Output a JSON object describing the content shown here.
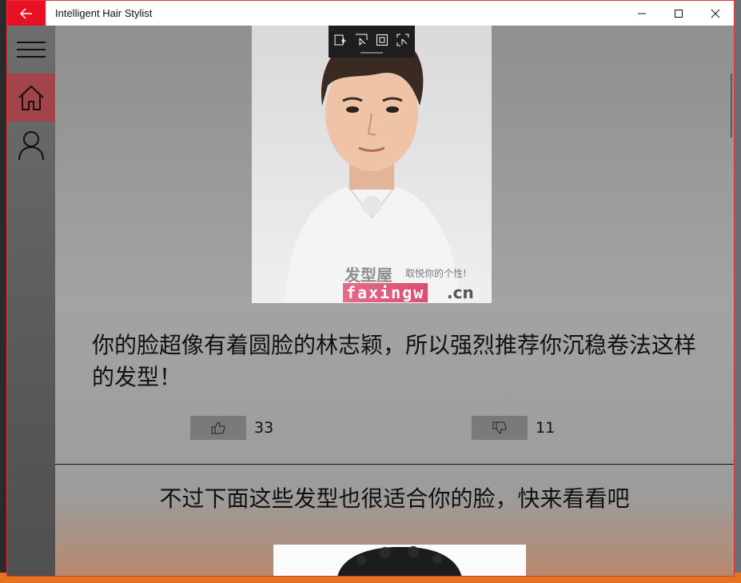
{
  "window": {
    "title": "Intelligent Hair Stylist"
  },
  "nav": {
    "items": [
      {
        "icon": "hamburger-icon"
      },
      {
        "icon": "home-icon",
        "active": true
      },
      {
        "icon": "person-icon"
      }
    ]
  },
  "result": {
    "photo_watermark_cn": "发型屋",
    "photo_watermark_slogan": "取悦你的个性!",
    "photo_watermark_domain": "faxingw",
    "photo_watermark_tld": ".cn",
    "description": "你的脸超像有着圆脸的林志颖，所以强烈推荐你沉稳卷法这样的发型！",
    "likes": "33",
    "dislikes": "11"
  },
  "suggestions": {
    "heading": "不过下面这些发型也很适合你的脸，快来看看吧"
  },
  "colors": {
    "accent": "#e81123",
    "nav_active": "#a3434a"
  }
}
